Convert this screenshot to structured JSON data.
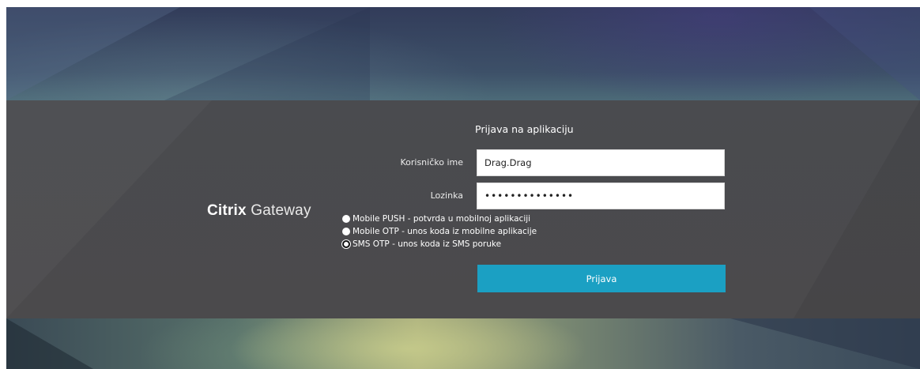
{
  "brand": {
    "name": "Citrix",
    "product": "Gateway"
  },
  "login": {
    "title": "Prijava na aplikaciju",
    "username_label": "Korisničko ime",
    "username_value": "Drag.Drag",
    "password_label": "Lozinka",
    "password_value": "••••••••••••••",
    "submit_label": "Prijava"
  },
  "auth_methods": [
    {
      "label": "Mobile PUSH - potvrda u mobilnoj aplikaciji",
      "selected": false
    },
    {
      "label": "Mobile OTP - unos koda iz mobilne aplikacije",
      "selected": false
    },
    {
      "label": "SMS OTP - unos koda iz SMS poruke",
      "selected": true
    }
  ],
  "colors": {
    "accent": "#1ba0c3",
    "band": "#4a4b4f",
    "text": "#ffffff"
  },
  "icons": {
    "radio_unchecked": "radio-unchecked-icon",
    "radio_checked": "radio-checked-icon"
  }
}
